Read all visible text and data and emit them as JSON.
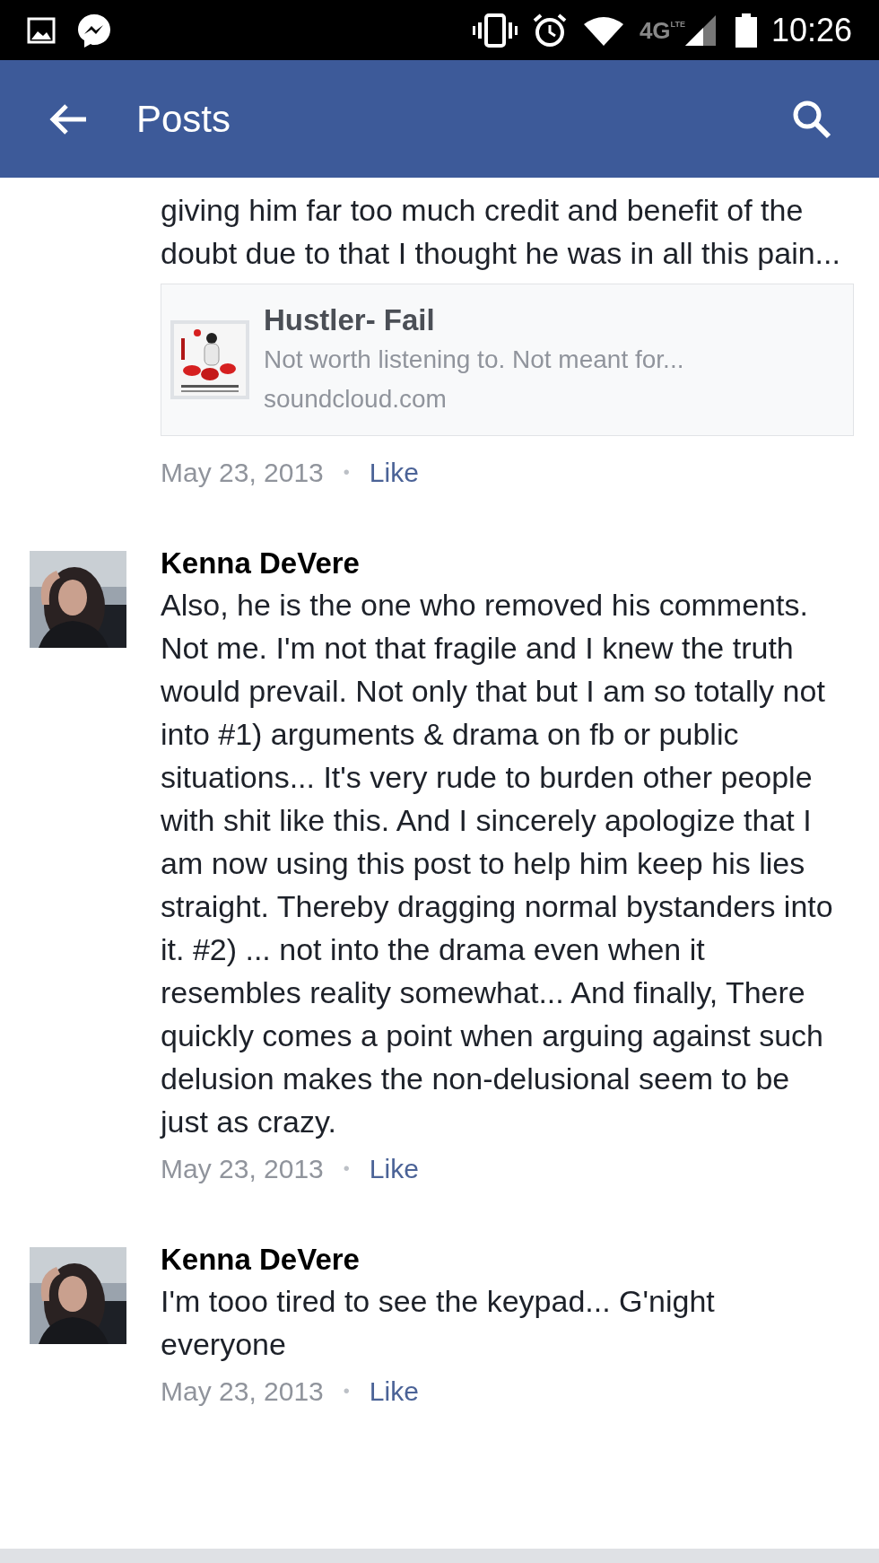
{
  "status_bar": {
    "network": "4G",
    "network_sub": "LTE",
    "time": "10:26"
  },
  "app_bar": {
    "title": "Posts"
  },
  "comments": [
    {
      "text": "giving him far too much credit and benefit of the doubt due to that I thought he was in all this pain...",
      "link_card": {
        "title": "Hustler- Fail",
        "description": "Not worth listening to. Not meant for...",
        "domain": "soundcloud.com"
      },
      "date": "May 23, 2013",
      "separator": "•",
      "action": "Like"
    },
    {
      "author": "Kenna DeVere",
      "text": "Also, he is the one who removed his comments. Not me. I'm not that fragile and I knew the truth would prevail. Not only that but I am so totally not into #1) arguments & drama on fb or public situations... It's very rude to burden other people with shit like this. And I sincerely apologize that I am now using this post to help him keep his lies straight. Thereby dragging normal bystanders into it. #2) ... not into the drama even when it resembles reality somewhat... And finally, There quickly comes a point when arguing against such delusion makes the non-delusional seem to be just as crazy.",
      "date": "May 23, 2013",
      "separator": "•",
      "action": "Like"
    },
    {
      "author": "Kenna DeVere",
      "text": "I'm tooo tired to see the keypad... G'night everyone",
      "date": "May 23, 2013",
      "separator": "•",
      "action": "Like"
    }
  ]
}
